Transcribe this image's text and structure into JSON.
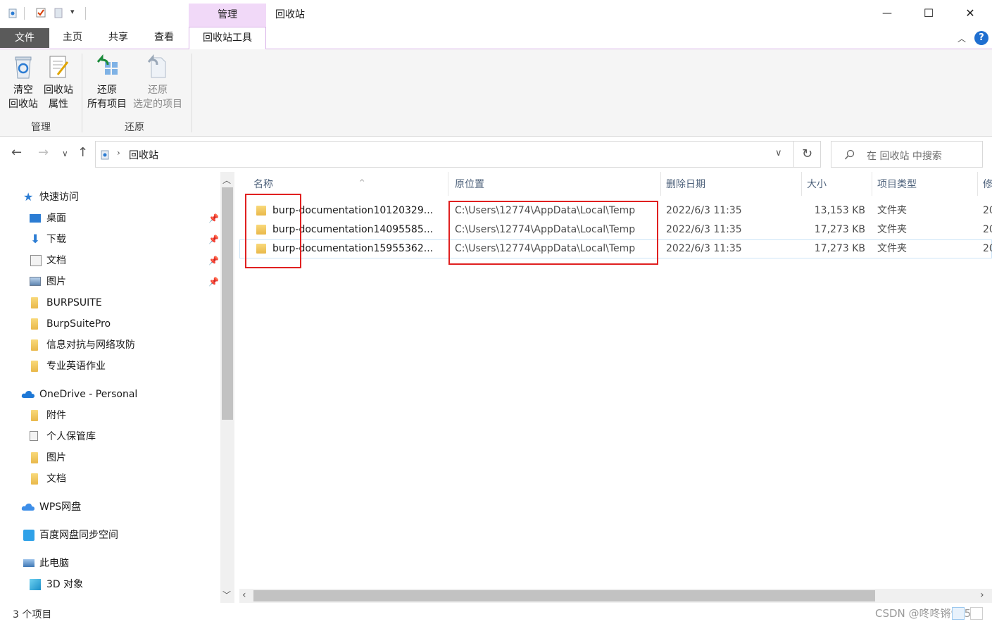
{
  "window": {
    "title": "回收站",
    "context_tab_group": "管理",
    "controls": {
      "minimize": "—",
      "maximize": "☐",
      "close": "✕"
    }
  },
  "ribbon": {
    "tabs": [
      {
        "label": "文件"
      },
      {
        "label": "主页"
      },
      {
        "label": "共享"
      },
      {
        "label": "查看"
      },
      {
        "label": "回收站工具"
      }
    ],
    "buttons": {
      "empty_line1": "清空",
      "empty_line2": "回收站",
      "props_line1": "回收站",
      "props_line2": "属性",
      "restore_all_line1": "还原",
      "restore_all_line2": "所有项目",
      "restore_sel_line1": "还原",
      "restore_sel_line2": "选定的项目"
    },
    "groups": {
      "manage": "管理",
      "restore": "还原"
    }
  },
  "address": {
    "path": "回收站",
    "search_placeholder": "在 回收站 中搜索"
  },
  "nav": {
    "quick_access": "快速访问",
    "quick_items": [
      "桌面",
      "下载",
      "文档",
      "图片",
      "BURPSUITE",
      "BurpSuitePro",
      "信息对抗与网络攻防",
      "专业英语作业"
    ],
    "onedrive": "OneDrive - Personal",
    "onedrive_items": [
      "附件",
      "个人保管库",
      "图片",
      "文档"
    ],
    "wps": "WPS网盘",
    "baidu": "百度网盘同步空间",
    "this_pc": "此电脑",
    "pc_items": [
      "3D 对象"
    ]
  },
  "columns": {
    "name": "名称",
    "location": "原位置",
    "deleted": "删除日期",
    "size": "大小",
    "type": "项目类型",
    "modified": "修"
  },
  "files": [
    {
      "name": "burp-documentation10120329...",
      "location": "C:\\Users\\12774\\AppData\\Local\\Temp",
      "deleted": "2022/6/3 11:35",
      "size": "13,153 KB",
      "type": "文件夹",
      "modified": "20"
    },
    {
      "name": "burp-documentation14095585...",
      "location": "C:\\Users\\12774\\AppData\\Local\\Temp",
      "deleted": "2022/6/3 11:35",
      "size": "17,273 KB",
      "type": "文件夹",
      "modified": "20"
    },
    {
      "name": "burp-documentation15955362...",
      "location": "C:\\Users\\12774\\AppData\\Local\\Temp",
      "deleted": "2022/6/3 11:35",
      "size": "17,273 KB",
      "type": "文件夹",
      "modified": "20"
    }
  ],
  "status": {
    "count": "3 个项目",
    "watermark": "CSDN @咚咚锵995"
  },
  "colors": {
    "accent_context": "#f1d9f8",
    "file_tab": "#5a5a5a",
    "highlight_box": "#e02020",
    "help": "#1f6fd0"
  }
}
